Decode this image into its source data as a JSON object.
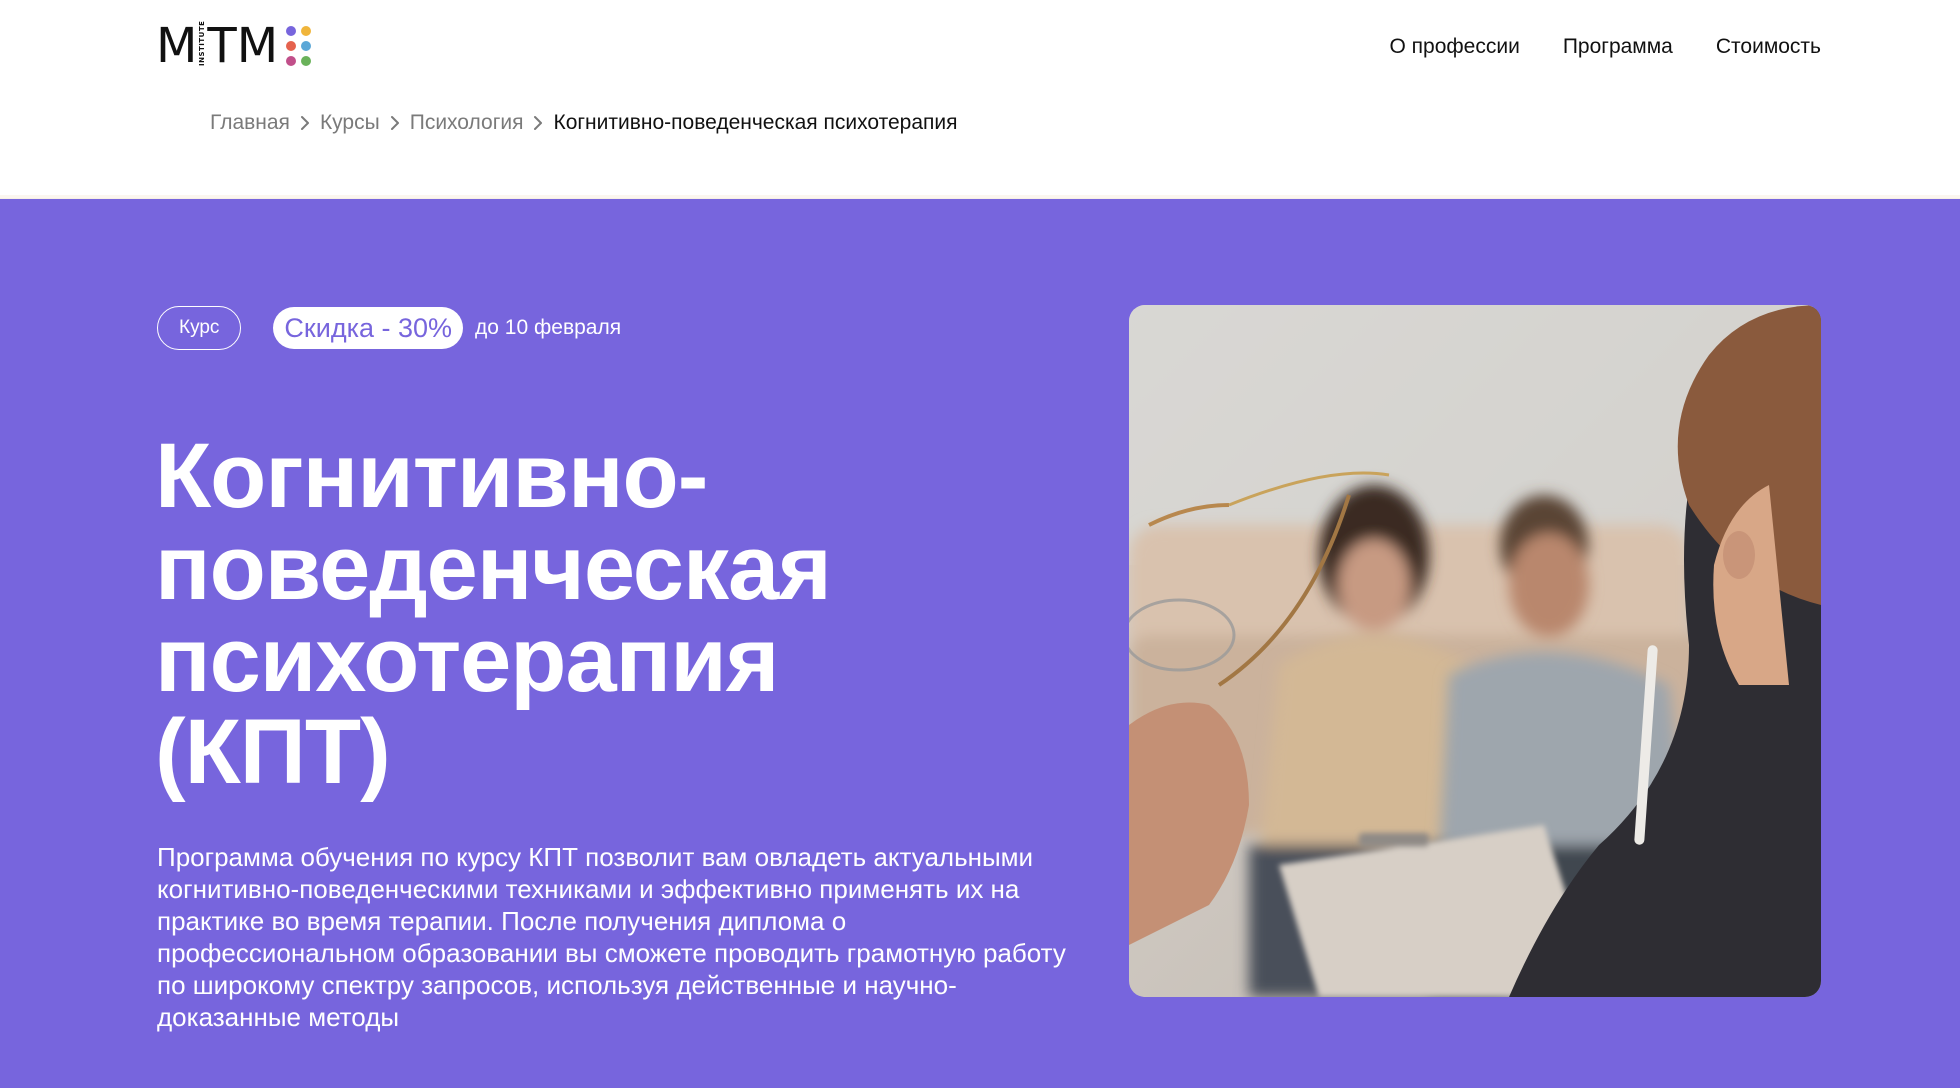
{
  "logo": {
    "text": "MITM",
    "word_left": "M",
    "sub": "INSTITUTE",
    "word_right": "TM",
    "dot_colors": [
      "#7765DD",
      "#F0B53B",
      "#E5624E",
      "#5BA7D7",
      "#C14F8A",
      "#6AB25A"
    ]
  },
  "nav": {
    "items": [
      "О профессии",
      "Программа",
      "Стоимость"
    ]
  },
  "breadcrumb": {
    "items": [
      "Главная",
      "Курсы",
      "Психология"
    ],
    "current": "Когнитивно-поведенческая психотерапия"
  },
  "hero": {
    "tag_course": "Курс",
    "discount": "Скидка - 30%",
    "deadline": "до 10 февраля",
    "title_lines": [
      "Когнитивно-",
      "поведенческая",
      "психотерапия",
      "(КПТ)"
    ],
    "description": "Программа обучения по курсу КПТ позволит вам овладеть актуальными когнитивно-поведенческими техниками и эффективно применять их на практике во время терапии. После получения диплома о профессиональном образовании вы сможете проводить грамотную работу по широкому спектру запросов, используя действенные и научно-доказанные методы",
    "photo": "therapy-session-photo"
  },
  "colors": {
    "accent": "#7765DD",
    "text_dark": "#111111",
    "text_muted": "#7A7A7A",
    "white": "#FFFFFF"
  }
}
